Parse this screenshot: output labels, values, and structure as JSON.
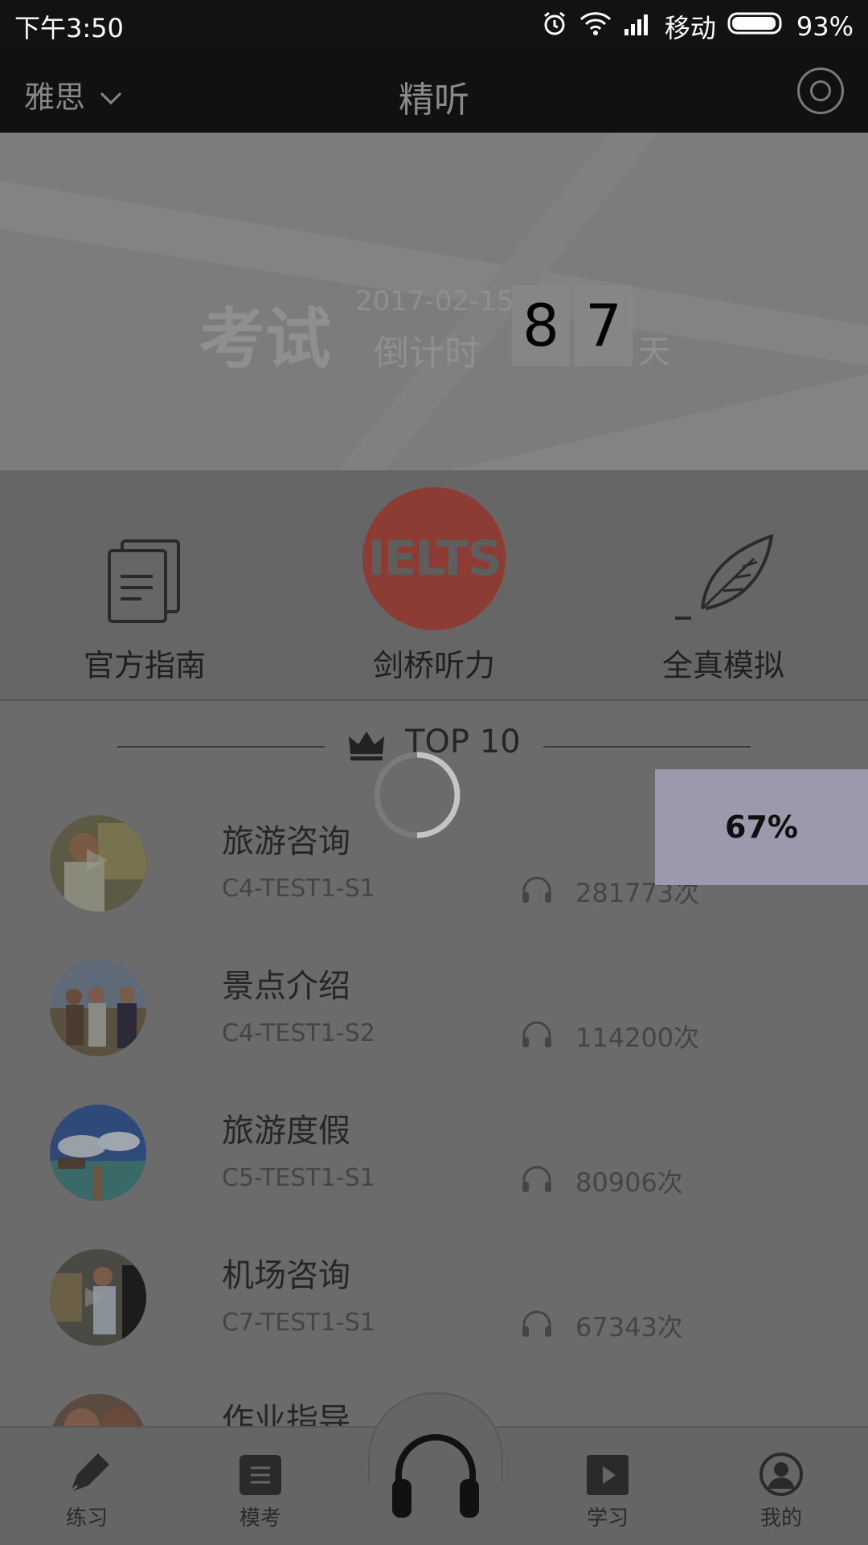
{
  "status_bar": {
    "time": "下午3:50",
    "carrier": "移动",
    "battery": "93%"
  },
  "header": {
    "exam_selector": "雅思",
    "title": "精听"
  },
  "banner": {
    "exam_word": "考试",
    "date": "2017-02-15",
    "countdown_label": "倒计时",
    "digits": [
      "8",
      "7"
    ],
    "day_unit": "天"
  },
  "shortcuts": [
    {
      "label": "官方指南",
      "icon": "document-icon"
    },
    {
      "label": "剑桥听力",
      "icon": "ielts-logo",
      "logo_text": "IELTS"
    },
    {
      "label": "全真模拟",
      "icon": "feather-icon"
    }
  ],
  "top_section": {
    "title": "TOP  10"
  },
  "list": [
    {
      "title": "旅游咨询",
      "code": "C4-TEST1-S1",
      "plays": "281773次"
    },
    {
      "title": "景点介绍",
      "code": "C4-TEST1-S2",
      "plays": "114200次"
    },
    {
      "title": "旅游度假",
      "code": "C5-TEST1-S1",
      "plays": "80906次"
    },
    {
      "title": "机场咨询",
      "code": "C7-TEST1-S1",
      "plays": "67343次"
    },
    {
      "title": "作业指导",
      "code": "",
      "plays": ""
    }
  ],
  "loading": {
    "progress_text": "67%"
  },
  "tabbar": [
    {
      "label": "练习",
      "icon": "pencil-icon"
    },
    {
      "label": "模考",
      "icon": "exam-icon"
    },
    {
      "label": "",
      "icon": "headphones-icon"
    },
    {
      "label": "学习",
      "icon": "play-icon"
    },
    {
      "label": "我的",
      "icon": "profile-icon"
    }
  ],
  "colors": {
    "overlay": "#6b6b6b",
    "ielts_red": "#8c3c32",
    "progress_card": "#9d99ac"
  }
}
